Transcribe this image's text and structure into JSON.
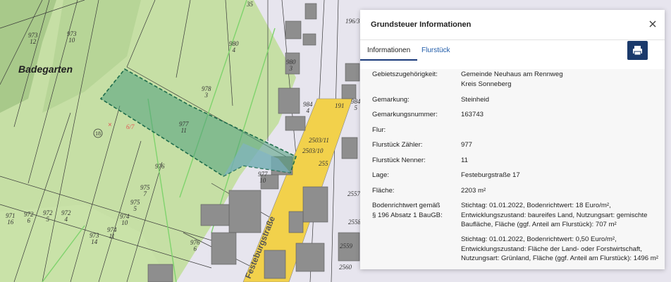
{
  "map": {
    "place_label": "Badegarten",
    "street_label": "Festeburgstraße",
    "marker_number": "18",
    "parcel_labels": [
      {
        "id": "p973-12",
        "text": "973\n12"
      },
      {
        "id": "p973-10",
        "text": "973\n10"
      },
      {
        "id": "p980-4",
        "text": "980\n4"
      },
      {
        "id": "p980-3",
        "text": "980\n3"
      },
      {
        "id": "p978-3",
        "text": "978\n3"
      },
      {
        "id": "p977-11",
        "text": "977\n11"
      },
      {
        "id": "p976",
        "text": "976"
      },
      {
        "id": "p977-10",
        "text": "977\n10"
      },
      {
        "id": "p975-7",
        "text": "975\n7"
      },
      {
        "id": "p975-5",
        "text": "975\n5"
      },
      {
        "id": "p974-10",
        "text": "974\n10"
      },
      {
        "id": "p974-11",
        "text": "974\n11"
      },
      {
        "id": "p973-14",
        "text": "973\n14"
      },
      {
        "id": "p971-16",
        "text": "971\n16"
      },
      {
        "id": "p972-6",
        "text": "972\n6"
      },
      {
        "id": "p972-5",
        "text": "972\n5"
      },
      {
        "id": "p972-4",
        "text": "972\n4"
      },
      {
        "id": "p976-6",
        "text": "976\n6"
      },
      {
        "id": "p984-4",
        "text": "984\n4"
      },
      {
        "id": "p984-5",
        "text": "984\n5"
      },
      {
        "id": "p191",
        "text": "191"
      },
      {
        "id": "p2503-11",
        "text": "2503/11"
      },
      {
        "id": "p2503-10",
        "text": "2503/10"
      },
      {
        "id": "p2557",
        "text": "2557"
      },
      {
        "id": "p2558",
        "text": "2558"
      },
      {
        "id": "p2559",
        "text": "2559"
      },
      {
        "id": "p2560",
        "text": "2560"
      },
      {
        "id": "p196-3",
        "text": "196/3"
      },
      {
        "id": "p255",
        "text": "255"
      },
      {
        "id": "p6-7",
        "text": "6/7"
      },
      {
        "id": "p35",
        "text": "35"
      }
    ]
  },
  "panel": {
    "title": "Grundsteuer Informationen",
    "close_icon": "close-icon",
    "print_icon": "printer-icon",
    "tabs": [
      {
        "label": "Informationen",
        "active": true
      },
      {
        "label": "Flurstück",
        "active": false
      }
    ],
    "rows": [
      {
        "label": "Gebietszugehörigkeit:",
        "value": "Gemeinde Neuhaus am Rennweg\nKreis Sonneberg"
      },
      {
        "label": "Gemarkung:",
        "value": "Steinheid"
      },
      {
        "label": "Gemarkungsnummer:",
        "value": "163743"
      },
      {
        "label": "Flur:",
        "value": ""
      },
      {
        "label": "Flurstück Zähler:",
        "value": "977"
      },
      {
        "label": "Flurstück Nenner:",
        "value": "11"
      },
      {
        "label": "Lage:",
        "value": "Festeburgstraße 17"
      },
      {
        "label": "Fläche:",
        "value": "2203 m²"
      },
      {
        "label": "Bodenrichtwert gemäß\n§ 196 Absatz 1 BauGB:",
        "value": "Stichtag: 01.01.2022, Bodenrichtwert: 18 Euro/m²,\nEntwicklungszustand: baureifes Land, Nutzungsart: gemischte\nBaufläche, Fläche (ggf. Anteil am Flurstück): 707 m²"
      },
      {
        "label": "",
        "value": "Stichtag: 01.01.2022, Bodenrichtwert: 0,50 Euro/m²,\nEntwicklungszustand: Fläche der Land- oder Forstwirtschaft,\nNutzungsart: Grünland, Fläche (ggf. Anteil am Flurstück): 1496 m²"
      }
    ]
  },
  "colors": {
    "accent": "#1b3a6b",
    "tab_link": "#1e5aa8",
    "parcel_highlight": "#3f9b73",
    "road": "#f2d14b"
  }
}
